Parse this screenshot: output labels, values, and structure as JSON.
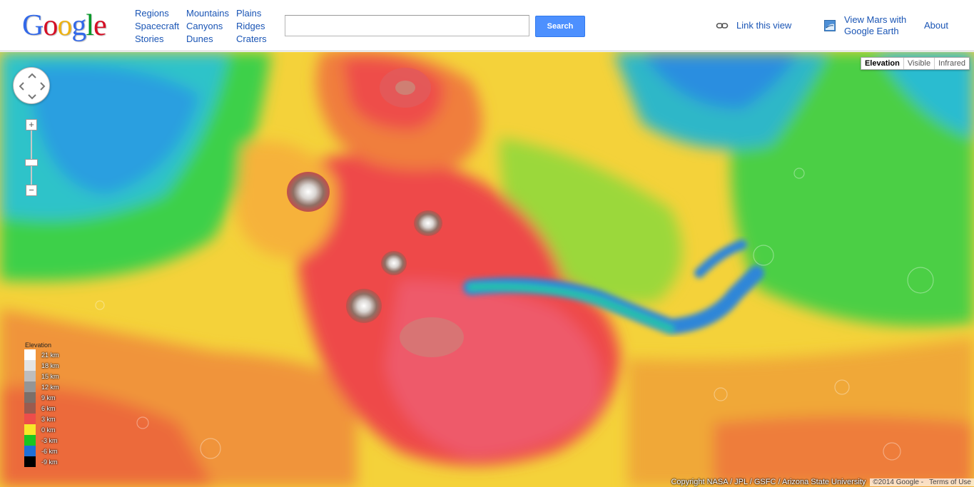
{
  "header": {
    "logo": [
      "G",
      "o",
      "o",
      "g",
      "l",
      "e"
    ],
    "nav_col1": [
      "Regions",
      "Spacecraft",
      "Stories"
    ],
    "nav_col2": [
      "Mountains",
      "Canyons",
      "Dunes"
    ],
    "nav_col3": [
      "Plains",
      "Ridges",
      "Craters"
    ],
    "search": {
      "value": "",
      "placeholder": "",
      "button": "Search"
    },
    "link_view": "Link this view",
    "google_earth": "View Mars with Google Earth",
    "about": "About"
  },
  "map": {
    "map_types": [
      {
        "label": "Elevation",
        "active": true
      },
      {
        "label": "Visible",
        "active": false
      },
      {
        "label": "Infrared",
        "active": false
      }
    ],
    "zoom": {
      "in": "+",
      "out": "−"
    },
    "legend": {
      "title": "Elevation",
      "entries": [
        {
          "label": "21 km",
          "color": "#ffffff"
        },
        {
          "label": "18 km",
          "color": "#e4e4e4"
        },
        {
          "label": "15 km",
          "color": "#bdbdbd"
        },
        {
          "label": "12 km",
          "color": "#959595"
        },
        {
          "label": "9 km",
          "color": "#7c6f69"
        },
        {
          "label": "6 km",
          "color": "#9a5b4f"
        },
        {
          "label": "3 km",
          "color": "#ee4d4a"
        },
        {
          "label": "0 km",
          "color": "#f7e728"
        },
        {
          "label": "-3 km",
          "color": "#19c521"
        },
        {
          "label": "-6 km",
          "color": "#1e6fd8"
        },
        {
          "label": "-9 km",
          "color": "#000000"
        }
      ]
    },
    "copyright": "Copyright NASA / JPL / GSFC / Arizona State University",
    "copyright_google": "©2014 Google -",
    "terms": "Terms of Use",
    "colors": {
      "logo_blue": "#3369e8",
      "logo_red": "#d50f25",
      "logo_yellow": "#eeb211",
      "logo_green": "#009925",
      "link": "#1a55b5",
      "button": "#4d90fe"
    }
  }
}
